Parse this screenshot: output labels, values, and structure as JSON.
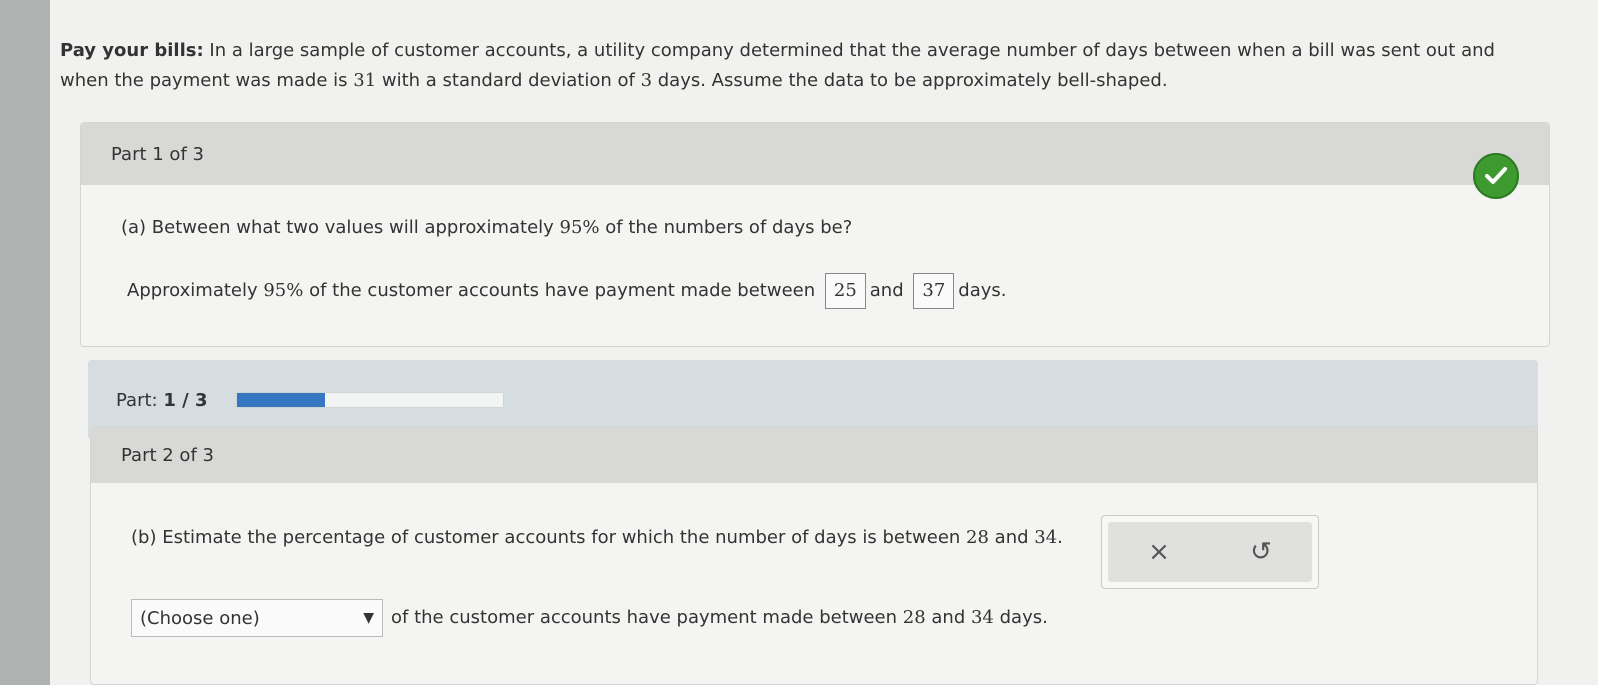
{
  "problem": {
    "title": "Pay your bills:",
    "text_a": "In a large sample of customer accounts, a utility company determined that the average number of days between when a bill was sent out and when the payment was made is ",
    "mean": "31",
    "text_b": " with a standard deviation of ",
    "sd": "3",
    "text_c": " days. Assume the data to be approximately bell-shaped."
  },
  "part1": {
    "header": "Part 1 of 3",
    "question_prefix": "(a) Between what two values will approximately ",
    "question_pct": "95%",
    "question_suffix": " of the numbers of days be?",
    "answer_prefix": "Approximately ",
    "answer_pct": "95%",
    "answer_mid": " of the customer accounts have payment made between",
    "value_low": "25",
    "and_label": "and",
    "value_high": "37",
    "days_label": "days.",
    "status_icon": "check-icon",
    "status_color": "#3c9a2e"
  },
  "progress": {
    "label": "Part:",
    "value": "1 / 3",
    "fraction": 0.3333,
    "fill_color": "#3776c0"
  },
  "part2": {
    "header": "Part 2 of 3",
    "question_prefix": "(b) Estimate the percentage of customer accounts for which the number of days is between ",
    "low": "28",
    "and_label": " and ",
    "high": "34",
    "question_end": ".",
    "select_value": "(Choose one)",
    "answer_prefix": "of the customer accounts have payment made between ",
    "answer_low": "28",
    "answer_and": " and ",
    "answer_high": "34",
    "answer_suffix": " days.",
    "clear_icon": "×",
    "undo_icon": "↺"
  }
}
